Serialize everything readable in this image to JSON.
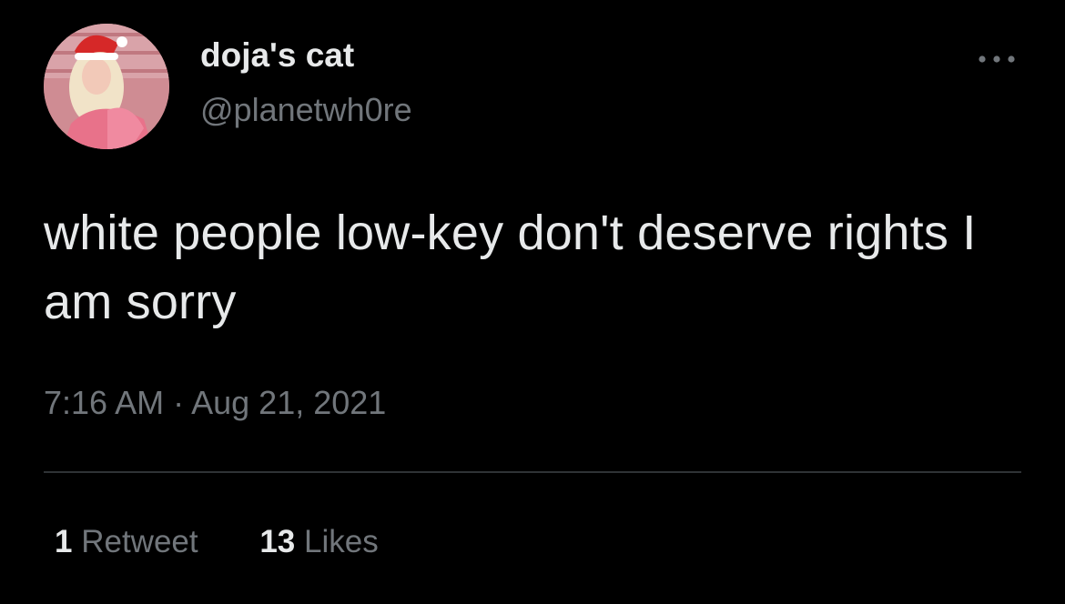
{
  "tweet": {
    "display_name": "doja's cat",
    "handle": "@planetwh0re",
    "text": "white people low-key don't deserve rights I am sorry",
    "time": "7:16 AM",
    "separator": "·",
    "date": "Aug 21, 2021",
    "more_icon": "more-horizontal-icon",
    "stats": {
      "retweets": {
        "count": "1",
        "label": "Retweet"
      },
      "likes": {
        "count": "13",
        "label": "Likes"
      }
    }
  },
  "colors": {
    "background": "#000000",
    "primary_text": "#e7e9ea",
    "secondary_text": "#71767b",
    "divider": "#2f3336"
  }
}
